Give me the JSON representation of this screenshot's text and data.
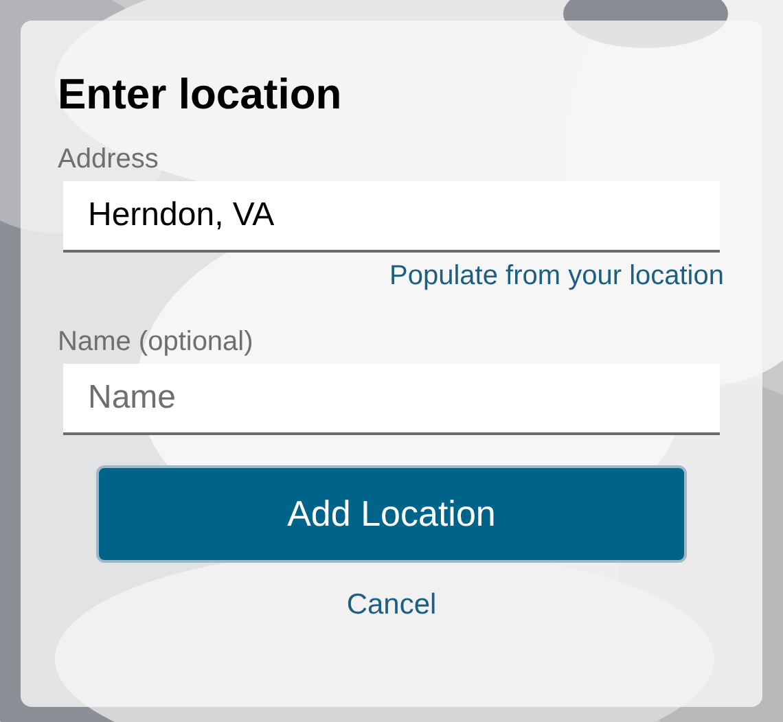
{
  "dialog": {
    "title": "Enter location",
    "address": {
      "label": "Address",
      "value": "Herndon, VA"
    },
    "populate_link": "Populate from your location",
    "name": {
      "label": "Name (optional)",
      "placeholder": "Name"
    },
    "add_button": "Add Location",
    "cancel_link": "Cancel"
  }
}
